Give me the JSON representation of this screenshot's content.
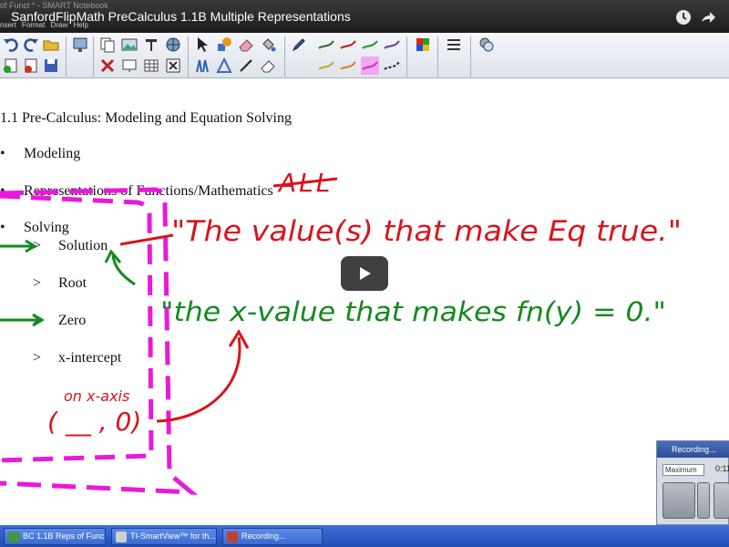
{
  "video": {
    "title": "SanfordFlipMath PreCalculus 1.1B Multiple Representations",
    "background_window_title": "of Funct * - SMART Notebook",
    "menu": "nsert  Format  Draw  Help"
  },
  "notebook": {
    "heading": "1.1 Pre-Calculus: Modeling and Equation Solving",
    "bullets": [
      {
        "marker": "•",
        "text": "Modeling"
      },
      {
        "marker": "•",
        "text": "Representations of Functions/Mathematics"
      },
      {
        "marker": "•",
        "text": "Solving"
      }
    ],
    "sub_items": [
      {
        "marker": ">",
        "text": "Solution"
      },
      {
        "marker": ">",
        "text": "Root"
      },
      {
        "marker": ">",
        "text": "Zero"
      },
      {
        "marker": ">",
        "text": "x-intercept"
      }
    ],
    "handwriting": {
      "all": "ALL",
      "red_quote": "\"The value(s) that make Eq true.\"",
      "green_quote": "\"the x-value that makes fn(y) = 0.\"",
      "on_x_axis": "on x-axis",
      "point": "( __ , 0)"
    },
    "ink_colors": {
      "red": "#d8141c",
      "green": "#138a1f",
      "magenta": "#e81ad8"
    }
  },
  "recording": {
    "title": "Recording...",
    "select": "Maximum",
    "time": "0:11"
  },
  "taskbar": {
    "tasks": [
      {
        "label": "BC 1.1B Reps of Func..."
      },
      {
        "label": "TI-SmartView™ for th..."
      },
      {
        "label": "Recording..."
      }
    ]
  }
}
